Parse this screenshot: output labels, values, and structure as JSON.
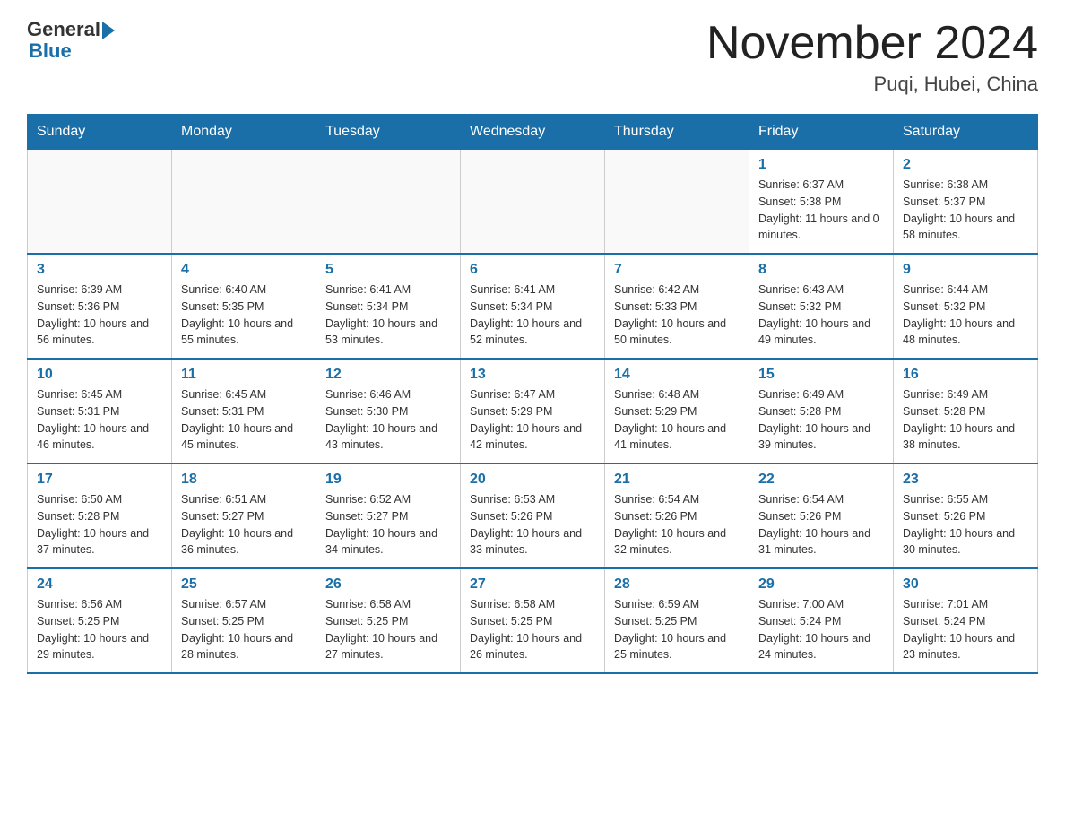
{
  "logo": {
    "general": "General",
    "blue": "Blue"
  },
  "title": "November 2024",
  "subtitle": "Puqi, Hubei, China",
  "headers": [
    "Sunday",
    "Monday",
    "Tuesday",
    "Wednesday",
    "Thursday",
    "Friday",
    "Saturday"
  ],
  "weeks": [
    [
      {
        "day": "",
        "info": ""
      },
      {
        "day": "",
        "info": ""
      },
      {
        "day": "",
        "info": ""
      },
      {
        "day": "",
        "info": ""
      },
      {
        "day": "",
        "info": ""
      },
      {
        "day": "1",
        "info": "Sunrise: 6:37 AM\nSunset: 5:38 PM\nDaylight: 11 hours and 0 minutes."
      },
      {
        "day": "2",
        "info": "Sunrise: 6:38 AM\nSunset: 5:37 PM\nDaylight: 10 hours and 58 minutes."
      }
    ],
    [
      {
        "day": "3",
        "info": "Sunrise: 6:39 AM\nSunset: 5:36 PM\nDaylight: 10 hours and 56 minutes."
      },
      {
        "day": "4",
        "info": "Sunrise: 6:40 AM\nSunset: 5:35 PM\nDaylight: 10 hours and 55 minutes."
      },
      {
        "day": "5",
        "info": "Sunrise: 6:41 AM\nSunset: 5:34 PM\nDaylight: 10 hours and 53 minutes."
      },
      {
        "day": "6",
        "info": "Sunrise: 6:41 AM\nSunset: 5:34 PM\nDaylight: 10 hours and 52 minutes."
      },
      {
        "day": "7",
        "info": "Sunrise: 6:42 AM\nSunset: 5:33 PM\nDaylight: 10 hours and 50 minutes."
      },
      {
        "day": "8",
        "info": "Sunrise: 6:43 AM\nSunset: 5:32 PM\nDaylight: 10 hours and 49 minutes."
      },
      {
        "day": "9",
        "info": "Sunrise: 6:44 AM\nSunset: 5:32 PM\nDaylight: 10 hours and 48 minutes."
      }
    ],
    [
      {
        "day": "10",
        "info": "Sunrise: 6:45 AM\nSunset: 5:31 PM\nDaylight: 10 hours and 46 minutes."
      },
      {
        "day": "11",
        "info": "Sunrise: 6:45 AM\nSunset: 5:31 PM\nDaylight: 10 hours and 45 minutes."
      },
      {
        "day": "12",
        "info": "Sunrise: 6:46 AM\nSunset: 5:30 PM\nDaylight: 10 hours and 43 minutes."
      },
      {
        "day": "13",
        "info": "Sunrise: 6:47 AM\nSunset: 5:29 PM\nDaylight: 10 hours and 42 minutes."
      },
      {
        "day": "14",
        "info": "Sunrise: 6:48 AM\nSunset: 5:29 PM\nDaylight: 10 hours and 41 minutes."
      },
      {
        "day": "15",
        "info": "Sunrise: 6:49 AM\nSunset: 5:28 PM\nDaylight: 10 hours and 39 minutes."
      },
      {
        "day": "16",
        "info": "Sunrise: 6:49 AM\nSunset: 5:28 PM\nDaylight: 10 hours and 38 minutes."
      }
    ],
    [
      {
        "day": "17",
        "info": "Sunrise: 6:50 AM\nSunset: 5:28 PM\nDaylight: 10 hours and 37 minutes."
      },
      {
        "day": "18",
        "info": "Sunrise: 6:51 AM\nSunset: 5:27 PM\nDaylight: 10 hours and 36 minutes."
      },
      {
        "day": "19",
        "info": "Sunrise: 6:52 AM\nSunset: 5:27 PM\nDaylight: 10 hours and 34 minutes."
      },
      {
        "day": "20",
        "info": "Sunrise: 6:53 AM\nSunset: 5:26 PM\nDaylight: 10 hours and 33 minutes."
      },
      {
        "day": "21",
        "info": "Sunrise: 6:54 AM\nSunset: 5:26 PM\nDaylight: 10 hours and 32 minutes."
      },
      {
        "day": "22",
        "info": "Sunrise: 6:54 AM\nSunset: 5:26 PM\nDaylight: 10 hours and 31 minutes."
      },
      {
        "day": "23",
        "info": "Sunrise: 6:55 AM\nSunset: 5:26 PM\nDaylight: 10 hours and 30 minutes."
      }
    ],
    [
      {
        "day": "24",
        "info": "Sunrise: 6:56 AM\nSunset: 5:25 PM\nDaylight: 10 hours and 29 minutes."
      },
      {
        "day": "25",
        "info": "Sunrise: 6:57 AM\nSunset: 5:25 PM\nDaylight: 10 hours and 28 minutes."
      },
      {
        "day": "26",
        "info": "Sunrise: 6:58 AM\nSunset: 5:25 PM\nDaylight: 10 hours and 27 minutes."
      },
      {
        "day": "27",
        "info": "Sunrise: 6:58 AM\nSunset: 5:25 PM\nDaylight: 10 hours and 26 minutes."
      },
      {
        "day": "28",
        "info": "Sunrise: 6:59 AM\nSunset: 5:25 PM\nDaylight: 10 hours and 25 minutes."
      },
      {
        "day": "29",
        "info": "Sunrise: 7:00 AM\nSunset: 5:24 PM\nDaylight: 10 hours and 24 minutes."
      },
      {
        "day": "30",
        "info": "Sunrise: 7:01 AM\nSunset: 5:24 PM\nDaylight: 10 hours and 23 minutes."
      }
    ]
  ]
}
